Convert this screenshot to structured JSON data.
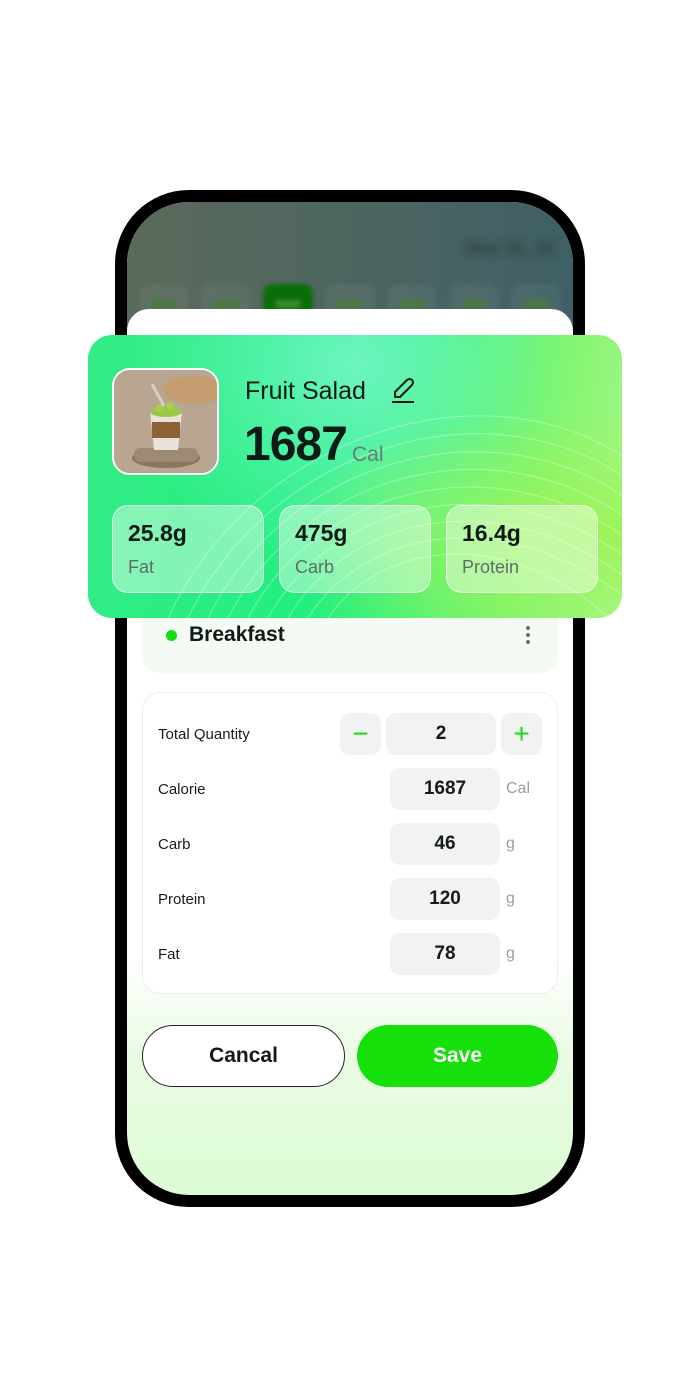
{
  "background": {
    "date_text": "May 01, 22",
    "day_chip_count": 7,
    "active_day_index": 2
  },
  "food": {
    "name": "Fruit Salad",
    "calories": "1687",
    "calories_unit": "Cal",
    "image_alt": "Fruit salad parfait in a glass jar",
    "macros": [
      {
        "value": "25.8g",
        "label": "Fat"
      },
      {
        "value": "475g",
        "label": "Carb"
      },
      {
        "value": "16.4g",
        "label": "Protein"
      }
    ]
  },
  "meal": {
    "title": "Breakfast",
    "dot_color": "#16dd12"
  },
  "form": {
    "quantity": {
      "label": "Total Quantity",
      "value": "2",
      "minus": "−",
      "plus": "+"
    },
    "rows": [
      {
        "label": "Calorie",
        "value": "1687",
        "unit": "Cal"
      },
      {
        "label": "Carb",
        "value": "46",
        "unit": "g"
      },
      {
        "label": "Protein",
        "value": "120",
        "unit": "g"
      },
      {
        "label": "Fat",
        "value": "78",
        "unit": "g"
      }
    ]
  },
  "actions": {
    "cancel_label": "Cancal",
    "save_label": "Save"
  },
  "colors": {
    "accent": "#16e00a",
    "text": "#121a18",
    "muted": "#9aa09e"
  }
}
